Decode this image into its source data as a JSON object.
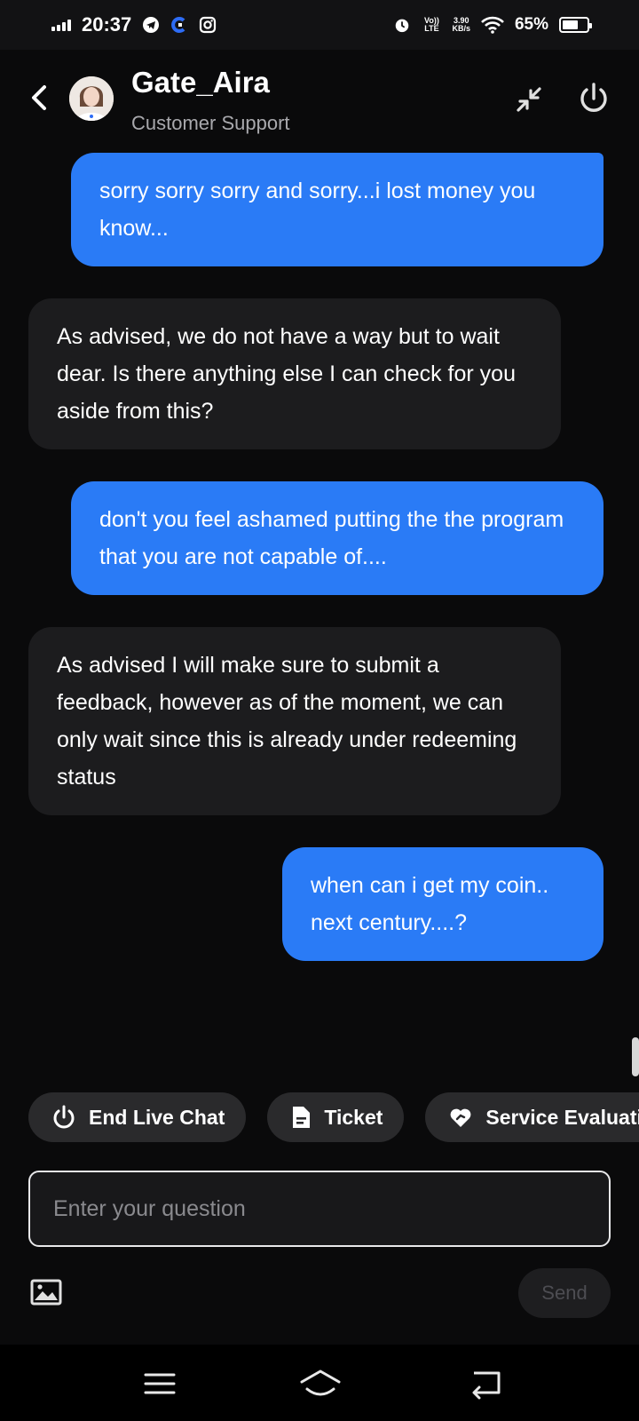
{
  "status_bar": {
    "time": "20:37",
    "volte": "Vo)) LTE",
    "speed_value": "3.90",
    "speed_unit": "KB/s",
    "battery": "65%",
    "battery_level": 0.65,
    "icons": [
      "signal-icon",
      "telegram-icon",
      "app-c-icon",
      "instagram-icon",
      "alarm-icon",
      "volte-icon",
      "wifi-icon",
      "battery-icon"
    ]
  },
  "header": {
    "title": "Gate_Aira",
    "subtitle": "Customer Support",
    "icons": [
      "back-icon",
      "avatar",
      "minimize-icon",
      "power-icon"
    ]
  },
  "messages": [
    {
      "sender": "user",
      "text": "sorry sorry sorry and sorry...i lost money you know..."
    },
    {
      "sender": "agent",
      "text": "As advised, we do not have a way but to wait dear. Is there anything else I can check for you aside from this?"
    },
    {
      "sender": "user",
      "text": "don't you feel ashamed putting the the program that you are not capable of...."
    },
    {
      "sender": "agent",
      "text": "As advised I will make sure to submit a feedback, however as of the moment, we can only wait since this is already under redeeming status"
    },
    {
      "sender": "user",
      "text": "when can i get my coin.. next century....?"
    }
  ],
  "quick_actions": [
    {
      "label": "End Live Chat",
      "icon": "power-icon"
    },
    {
      "label": "Ticket",
      "icon": "document-icon"
    },
    {
      "label": "Service Evaluati",
      "icon": "heart-hand-icon"
    }
  ],
  "composer": {
    "placeholder": "Enter your question",
    "value": "",
    "send_label": "Send",
    "image_icon": "image-icon"
  },
  "colors": {
    "background": "#0a0a0b",
    "user_bubble": "#2a7bf6",
    "agent_bubble": "#1c1c1e",
    "chip": "#2a2a2c"
  },
  "nav_bar": {
    "icons": [
      "menu-icon",
      "home-icon",
      "back-nav-icon"
    ]
  }
}
